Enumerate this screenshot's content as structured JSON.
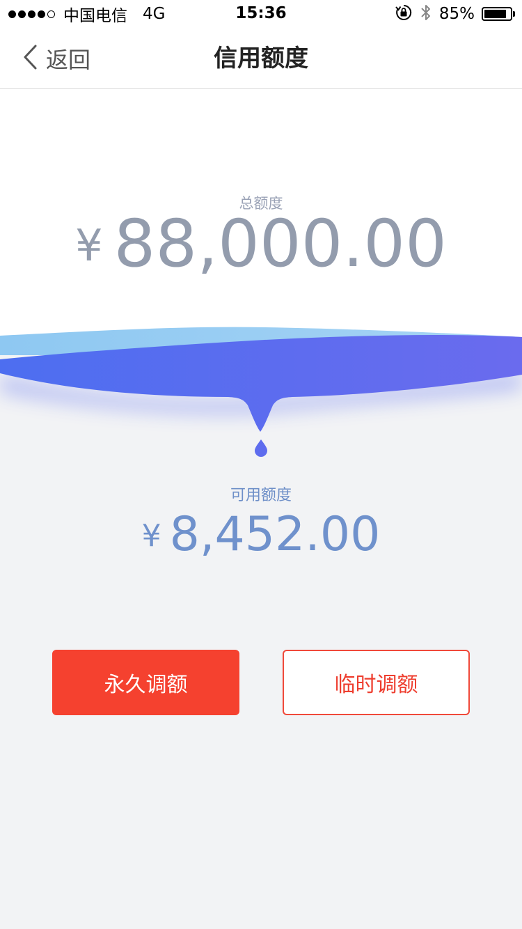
{
  "status_bar": {
    "carrier": "中国电信",
    "network": "4G",
    "time": "15:36",
    "battery": "85%",
    "battery_level": 0.85,
    "icons": [
      "signal-icon",
      "orientation-lock-icon",
      "bluetooth-icon",
      "battery-icon"
    ]
  },
  "nav": {
    "back_label": "返回",
    "title": "信用额度"
  },
  "credit": {
    "total_label": "总额度",
    "currency": "¥",
    "total_amount": "88,000.00",
    "available_label": "可用额度",
    "available_amount": "8,452.00"
  },
  "buttons": {
    "permanent": "永久调额",
    "temporary": "临时调额"
  },
  "colors": {
    "accent": "#f5412f",
    "wave_start": "#4d6ef0",
    "wave_end": "#6a6bee",
    "total_text": "#939cad",
    "available_text": "#6f91cc"
  }
}
